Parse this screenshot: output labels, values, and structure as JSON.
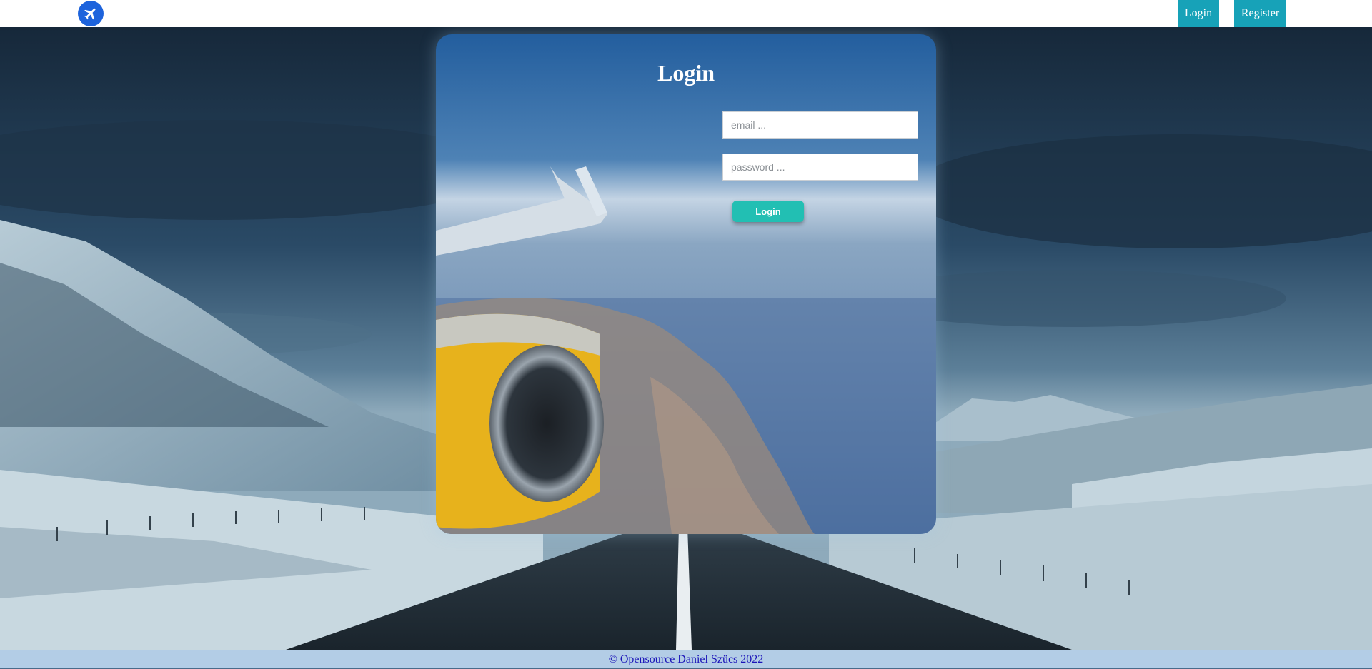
{
  "nav": {
    "logo_icon": "airplane-icon",
    "login_label": "Login",
    "register_label": "Register"
  },
  "card": {
    "title": "Login",
    "email_placeholder": "email ...",
    "password_placeholder": "password ...",
    "login_button_label": "Login"
  },
  "footer": {
    "text": "© Opensource Daniel Szücs 2022"
  },
  "colors": {
    "nav_button": "#17a2b8",
    "card_button": "#22bfb3",
    "logo": "#1d63dc",
    "footer_bg": "#b3cde6",
    "footer_text": "#1b14b8"
  }
}
